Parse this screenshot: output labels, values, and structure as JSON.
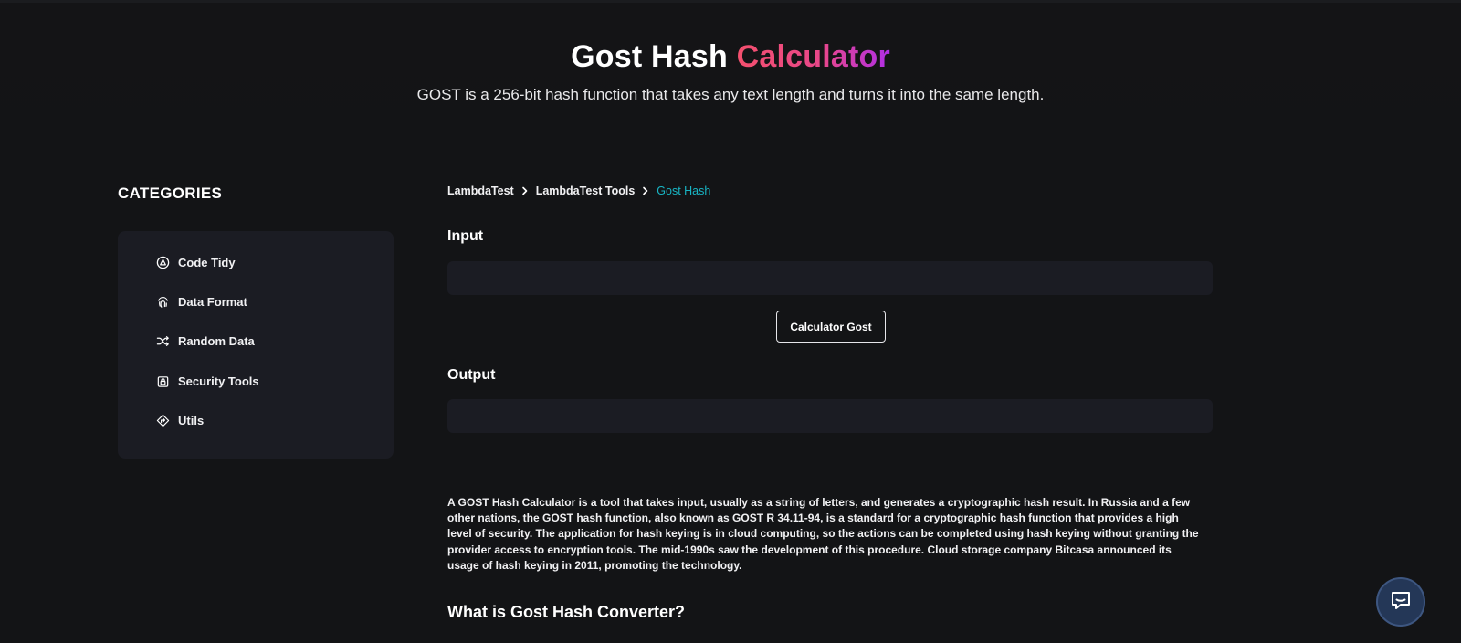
{
  "hero": {
    "title_main": "Gost Hash",
    "title_accent": "Calculator",
    "subtitle": "GOST is a 256-bit hash function that takes any text length and turns it into the same length."
  },
  "sidebar": {
    "heading": "CATEGORIES",
    "items": [
      {
        "label": "Code Tidy",
        "icon": "code-tidy-icon"
      },
      {
        "label": "Data Format",
        "icon": "fingerprint-icon"
      },
      {
        "label": "Random Data",
        "icon": "shuffle-icon"
      },
      {
        "label": "Security Tools",
        "icon": "lock-icon"
      },
      {
        "label": "Utils",
        "icon": "diamond-arrow-icon"
      }
    ]
  },
  "breadcrumb": [
    "LambdaTest",
    "LambdaTest Tools",
    "Gost Hash"
  ],
  "input": {
    "label": "Input",
    "value": "",
    "placeholder": ""
  },
  "button": {
    "label": "Calculator Gost"
  },
  "output": {
    "label": "Output",
    "value": "",
    "placeholder": ""
  },
  "description": "A GOST Hash Calculator is a tool that takes input, usually as a string of letters, and generates a cryptographic hash result. In Russia and a few other nations, the GOST hash function, also known as GOST R 34.11-94, is a standard for a cryptographic hash function that provides a high level of security. The application for hash keying is in cloud computing, so the actions can be completed using hash keying without granting the provider access to encryption tools. The mid-1990s saw the development of this procedure. Cloud storage company Bitcasa announced its usage of hash keying in 2011, promoting the technology.",
  "section_heading": "What is Gost Hash Converter?",
  "colors": {
    "background": "#131416",
    "panel": "#1b1c23",
    "accent_start": "#f4506e",
    "accent_end": "#b02ee6",
    "breadcrumb_active": "#18b5c4",
    "chat_button": "#243757"
  },
  "chat": {
    "icon": "chat-bubble-icon"
  }
}
